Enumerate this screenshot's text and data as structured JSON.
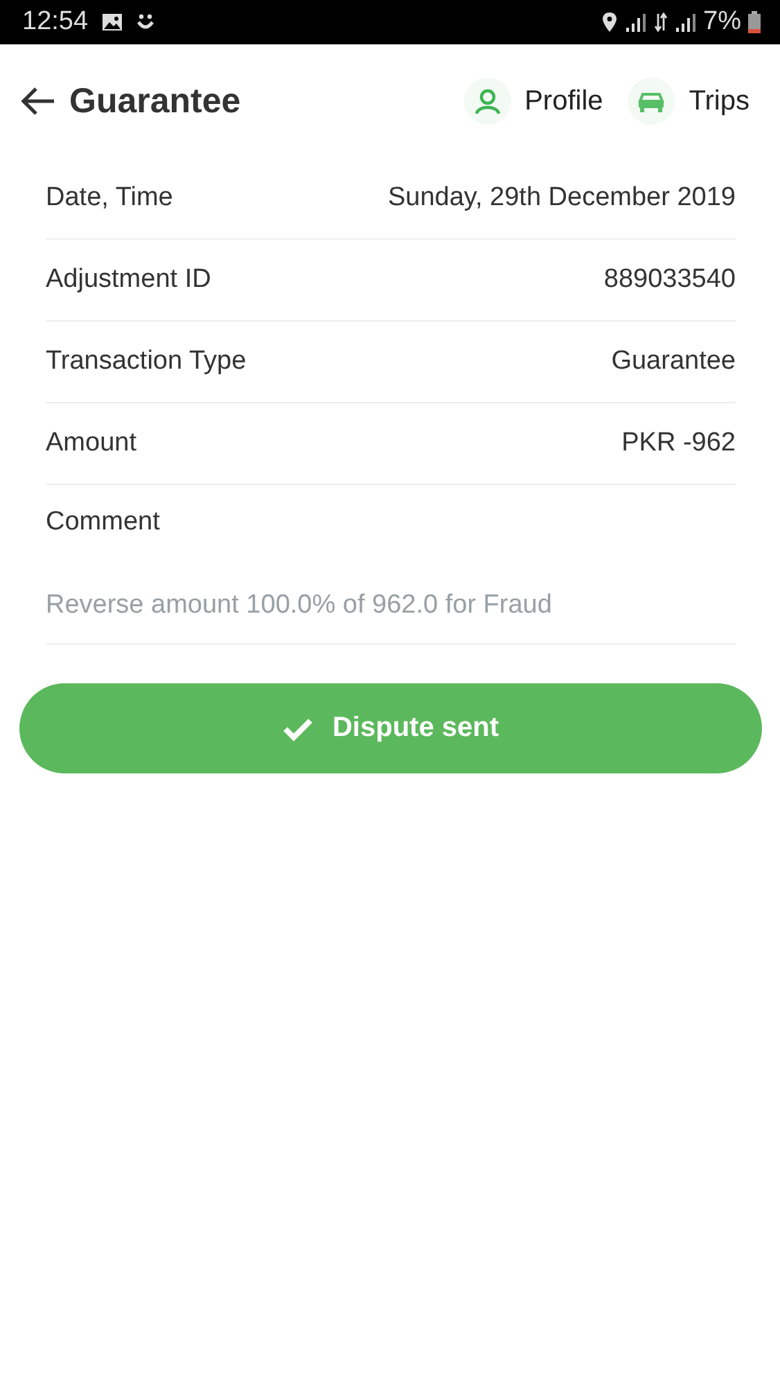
{
  "status_bar": {
    "time": "12:54",
    "battery": "7%"
  },
  "header": {
    "title": "Guarantee",
    "actions": [
      {
        "label": "Profile",
        "kind": "person"
      },
      {
        "label": "Trips",
        "kind": "car"
      }
    ]
  },
  "details": [
    {
      "label": "Date, Time",
      "value": "Sunday, 29th December 2019"
    },
    {
      "label": "Adjustment ID",
      "value": "889033540"
    },
    {
      "label": "Transaction Type",
      "value": "Guarantee"
    },
    {
      "label": "Amount",
      "value": "PKR -962"
    }
  ],
  "comment": {
    "label": "Comment",
    "text": "Reverse amount 100.0% of 962.0 for Fraud"
  },
  "button": {
    "label": "Dispute sent"
  }
}
